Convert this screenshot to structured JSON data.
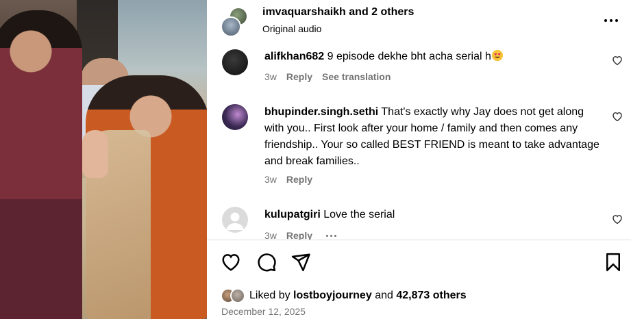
{
  "header": {
    "username": "imvaquarshaikh",
    "and_others": "and 2 others",
    "subtitle": "Original audio",
    "more_icon": "more-horizontal-icon"
  },
  "comments": [
    {
      "username": "alifkhan682",
      "text": "9 episode dekhe bht acha serial h",
      "emoji": "smiling-face-with-heart-eyes",
      "time": "3w",
      "reply": "Reply",
      "translate": "See translation"
    },
    {
      "username": "bhupinder.singh.sethi",
      "text": "That's exactly why Jay does not get along with you.. First look after your home / family and then comes any friendship.. Your so called BEST FRIEND is meant to take advantage and break families..",
      "time": "3w",
      "reply": "Reply"
    },
    {
      "username": "kulupatgiri",
      "text": "Love the serial",
      "time": "3w",
      "reply": "Reply"
    }
  ],
  "actions": {
    "like_icon": "heart-icon",
    "comment_icon": "comment-icon",
    "share_icon": "send-icon",
    "save_icon": "bookmark-icon"
  },
  "likes": {
    "prefix": "Liked by",
    "user": "lostboyjourney",
    "conj": "and",
    "count": "42,873 others"
  },
  "date": "December 12, 2025",
  "colors": {
    "secondary_text": "#737373",
    "divider": "#dbdbdb",
    "text": "#000000"
  }
}
